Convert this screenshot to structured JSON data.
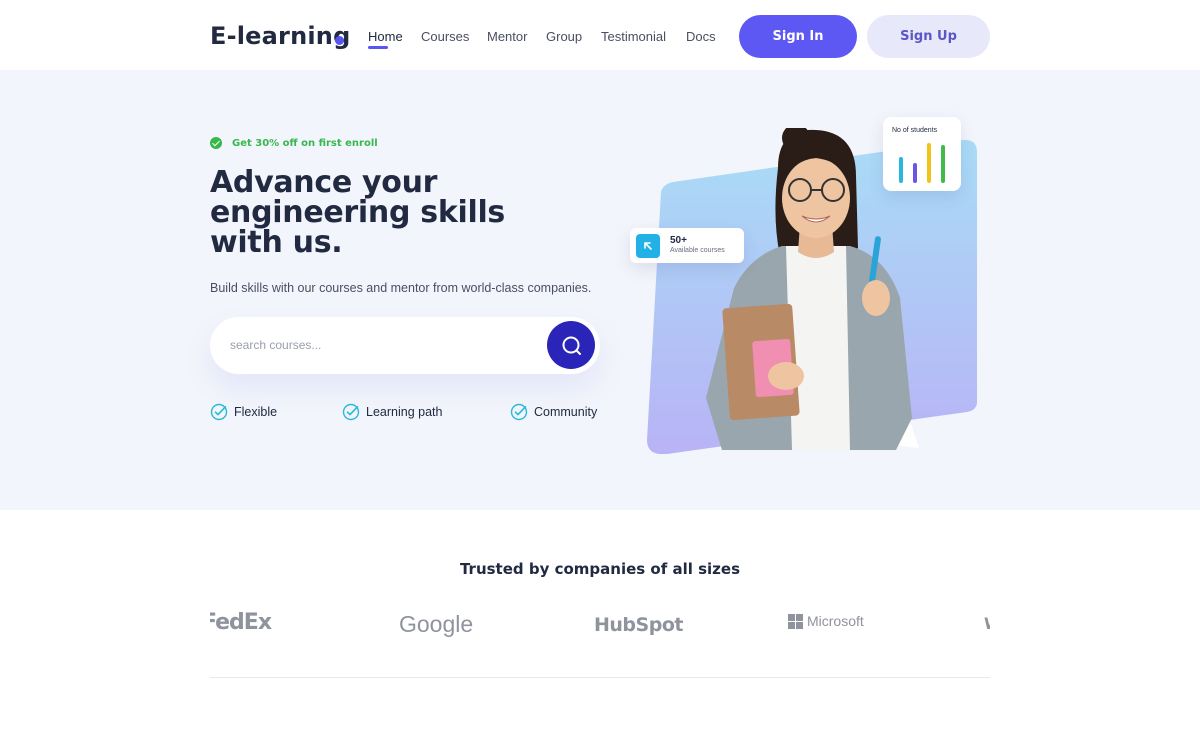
{
  "header": {
    "logo": "E-learning",
    "nav": [
      "Home",
      "Courses",
      "Mentor",
      "Group",
      "Testimonial",
      "Docs"
    ],
    "active_nav": "Home",
    "sign_in": "Sign In",
    "sign_up": "Sign Up"
  },
  "hero": {
    "promo": "Get 30% off on first enroll",
    "title": "Advance your engineering skills with us.",
    "subtitle": "Build skills with our courses and mentor from world-class companies.",
    "search": {
      "placeholder": "search courses..."
    },
    "features": [
      "Flexible",
      "Learning path",
      "Community"
    ],
    "courses_card": {
      "count": "50+",
      "label": "Available courses"
    },
    "students_card": {
      "label": "No of students"
    }
  },
  "trusted": {
    "heading": "Trusted by companies of all sizes",
    "logos": [
      "FedEx",
      "Google",
      "HubSpot",
      "Microsoft",
      "W"
    ]
  },
  "colors": {
    "accent": "#5d58f3",
    "accent_light": "#e8e8fb",
    "search_button": "#2a24b8",
    "promo_green": "#37b84d",
    "hero_bg": "#f2f5fb",
    "text_dark": "#222a41"
  },
  "icons": {
    "promo": "check-circle-icon",
    "search": "search-icon",
    "feature": "check-circle-outline-icon",
    "courses_card": "arrow-up-left-icon"
  }
}
